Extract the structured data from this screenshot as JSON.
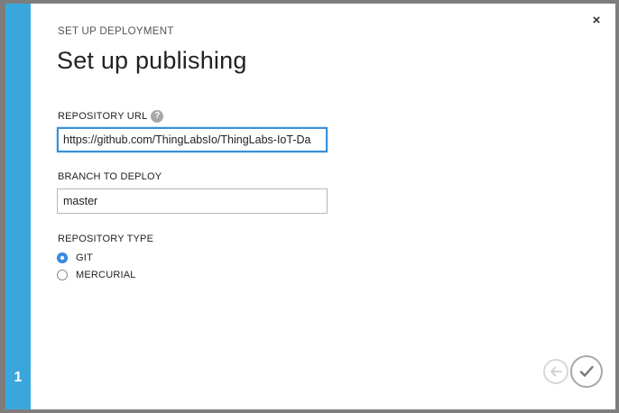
{
  "dialog": {
    "overline": "SET UP DEPLOYMENT",
    "title": "Set up publishing",
    "close_label": "×",
    "step_number": "1"
  },
  "form": {
    "repo_url": {
      "label": "REPOSITORY URL",
      "help": "?",
      "value": "https://github.com/ThingLabsIo/ThingLabs-IoT-Da"
    },
    "branch": {
      "label": "BRANCH TO DEPLOY",
      "value": "master"
    },
    "repo_type": {
      "label": "REPOSITORY TYPE",
      "options": [
        {
          "label": "GIT",
          "checked": true
        },
        {
          "label": "MERCURIAL",
          "checked": false
        }
      ]
    }
  },
  "icons": {
    "back": "arrow-left-icon",
    "next": "checkmark-icon",
    "close": "close-icon"
  },
  "colors": {
    "accent": "#3aa7dc",
    "focus": "#3b8fd9",
    "radio_selected": "#3b8fe0"
  }
}
